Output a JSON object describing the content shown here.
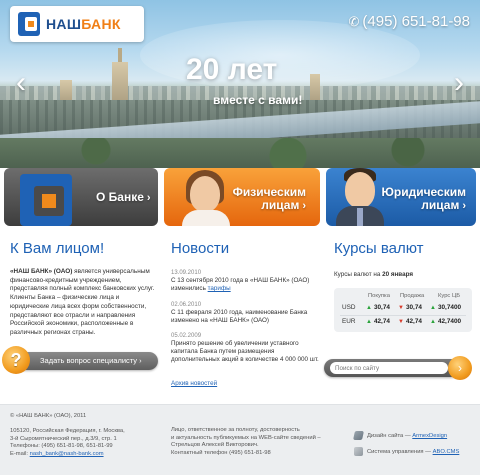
{
  "header": {
    "logo_part1": "НАШ",
    "logo_part2": "БАНК",
    "phone_icon": "phone-icon",
    "phone": "(495) 651-81-98",
    "slogan_main": "20 лет",
    "slogan_sub": "вместе с вами!",
    "arrow_left": "‹",
    "arrow_right": "›"
  },
  "banners": [
    {
      "label": "О Банке",
      "arrow": "›"
    },
    {
      "label_line1": "Физическим",
      "label_line2": "лицам",
      "arrow": "›"
    },
    {
      "label_line1": "Юридическим",
      "label_line2": "лицам",
      "arrow": "›"
    }
  ],
  "face": {
    "title": "К Вам лицом!",
    "bold": "«НАШ БАНК» (ОАО)",
    "text": " является универсальным финансово-кредитным учреждением, представляя полный комплекс банковских услуг. Клиенты Банка – физические лица и юридические лица всех форм собственности, представляют все отрасли и направления Российской экономики, расположенные в различных регионах страны.",
    "ask_icon": "?",
    "ask_label": "Задать вопрос специалисту",
    "ask_arrow": "›"
  },
  "news": {
    "title": "Новости",
    "items": [
      {
        "date": "13.09.2010",
        "text": "С 13 сентября 2010 года в «НАШ БАНК» (ОАО) изменились ",
        "link": "тарифы"
      },
      {
        "date": "02.06.2010",
        "text": "С 11 февраля 2010 года, наименование Банка изменено на «НАШ БАНК» (ОАО)",
        "link": ""
      },
      {
        "date": "05.02.2009",
        "text": "Принято решение об увеличении уставного капитала Банка путем размещения дополнительных акций в количестве 4 000 000 шт.",
        "link": ""
      }
    ],
    "archive": "Архив новостей"
  },
  "rates": {
    "title": "Курсы валют",
    "caption_prefix": "Курсы валют на ",
    "caption_date": "20 января",
    "headers": {
      "buy": "Покупка",
      "sell": "Продажа",
      "cb": "Курс ЦБ"
    },
    "rows": [
      {
        "code": "USD",
        "buy": "30,74",
        "sell": "30,74",
        "cb": "30,7400",
        "buy_dir": "up",
        "sell_dir": "down",
        "cb_dir": "up"
      },
      {
        "code": "EUR",
        "buy": "42,74",
        "sell": "42,74",
        "cb": "42,7400",
        "buy_dir": "up",
        "sell_dir": "down",
        "cb_dir": "up"
      }
    ]
  },
  "search": {
    "placeholder": "Поиск по сайту",
    "button_icon": "›"
  },
  "footer": {
    "copyright": "© «НАШ БАНК» (ОАО), 2011",
    "address_1": "105120, Российская Федерация, г. Москва,",
    "address_2": "3-й Сыромятнический пер., д.3/9, стр. 1",
    "address_3": "Телефоны: (495) 651-81-98, 651-81-99",
    "email_label": "E-mail: ",
    "email": "nash_bank@nash-bank.com",
    "resp_1": "Лицо, ответственное за полноту, достоверность",
    "resp_2": "и актуальность публикуемых на WEB-сайте сведений –",
    "resp_3": "Стрельцов Алексей Викторович.",
    "resp_4": "Контактный телефон (495) 651-81-98",
    "design_label": "Дизайн сайта — ",
    "design_link": "ArmexDesign",
    "cms_label": "Система управления — ",
    "cms_link": "ABO.CMS"
  },
  "colors": {
    "brand_blue": "#1f62b5",
    "brand_orange": "#f07f16",
    "up": "#2aa33b",
    "down": "#d83a2a"
  }
}
